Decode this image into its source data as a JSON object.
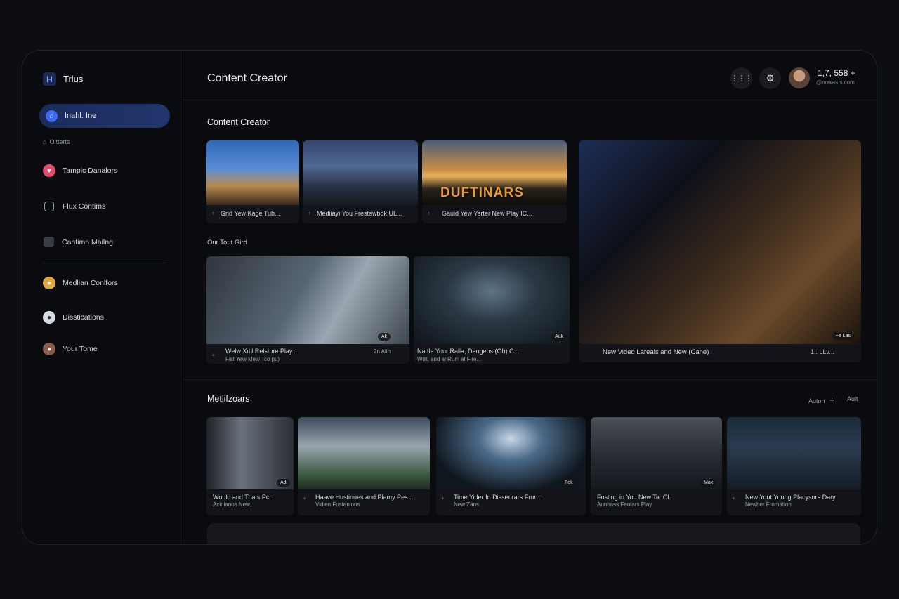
{
  "sidebar": {
    "brand_icon": "H",
    "brand": "Trlus",
    "active_item": {
      "label": "Inahl. Ine",
      "icon": "home-icon"
    },
    "section_label": "Oitterts",
    "items": [
      {
        "label": "Tampic Danalors",
        "icon": "heart-icon",
        "color": "#e24b6a"
      },
      {
        "label": "Flux Contims",
        "icon": "grid-icon",
        "color": "#3a3d45"
      },
      {
        "label": "Cantimn Mailng",
        "icon": "box-icon",
        "color": "#3a3d45"
      },
      {
        "label": "Medlian Conlfors",
        "icon": "avatar-icon",
        "color": "#e0a83a"
      },
      {
        "label": "Disstications",
        "icon": "avatar-icon",
        "color": "#d8dbe6"
      },
      {
        "label": "Your Tome",
        "icon": "avatar-icon",
        "color": "#8a5a4a"
      }
    ]
  },
  "header": {
    "title": "Content Creator",
    "account_number": "1,7, 558 +",
    "account_sub": "@nowas s.com",
    "buttons": [
      "apps-grid-icon",
      "gear-icon"
    ]
  },
  "section1": {
    "title": "Content Creator",
    "cards_top": [
      {
        "caption": "Grid Yew Kage Tub..."
      },
      {
        "caption": "Mediiayı You Frestewbok UL..."
      },
      {
        "caption": "Gauid Yew Yerter New Play IC...",
        "overlay": "DUFTINARS"
      }
    ],
    "subheading": "Our Tout Gird",
    "cards_mid": [
      {
        "caption": "Welw XıU Relsture Play...",
        "sub": "Fist Yew Mew Tco pu)",
        "meta": "2n Alin",
        "badge": "Ak"
      },
      {
        "caption": "Nattle Your Ralla, Dengens (Oh) C...",
        "sub": "Willl, and al Rum al Fire...",
        "badge": "Auk"
      }
    ],
    "feature": {
      "caption": "New Vided Lareals and New (Cane)",
      "meta": "1.. LLv...",
      "badge": "Fe Las"
    }
  },
  "section2": {
    "title": "Metlifzoars",
    "action1": "Auton",
    "action2": "Ault",
    "cards": [
      {
        "caption": "Would and Triats Pc.",
        "sub": "Acinianos New..",
        "badge": "Ad"
      },
      {
        "caption": "Haave Hustinues and Plamy Pes...",
        "sub": "Vidien Fustenions"
      },
      {
        "caption": "Time Yider In Disseurars Frur...",
        "sub": "New Zans.",
        "badge": "Fek"
      },
      {
        "caption": "Fusting in You New Ta. CL",
        "sub": "Aunbass Feotars Play",
        "badge": "Mak"
      },
      {
        "caption": "New Yout Young Placysors Dary",
        "sub": "Newber Fromation"
      }
    ]
  }
}
